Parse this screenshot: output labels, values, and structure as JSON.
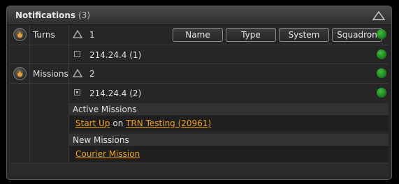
{
  "header": {
    "title": "Notifications",
    "count": "(3)",
    "collapse_icon": "triangle-up-icon"
  },
  "filters": {
    "name": "Name",
    "type": "Type",
    "system": "System",
    "squadron": "Squadron"
  },
  "groups": [
    {
      "name": "Turns",
      "icon": "faction-emblem-icon",
      "count": "1",
      "items": [
        {
          "host": "214.24.4 (1)"
        }
      ]
    },
    {
      "name": "Missions",
      "icon": "faction-emblem-icon",
      "count": "2",
      "items": [
        {
          "host": "214.24.4 (2)"
        }
      ]
    }
  ],
  "missions": {
    "active_header": "Active Missions",
    "active_link": "Start Up",
    "active_on": "on",
    "active_target": "TRN Testing (20961)",
    "new_header": "New Missions",
    "new_link": "Courier Mission"
  },
  "colors": {
    "status_online": "#2e9e2e",
    "link": "#f0a020"
  }
}
